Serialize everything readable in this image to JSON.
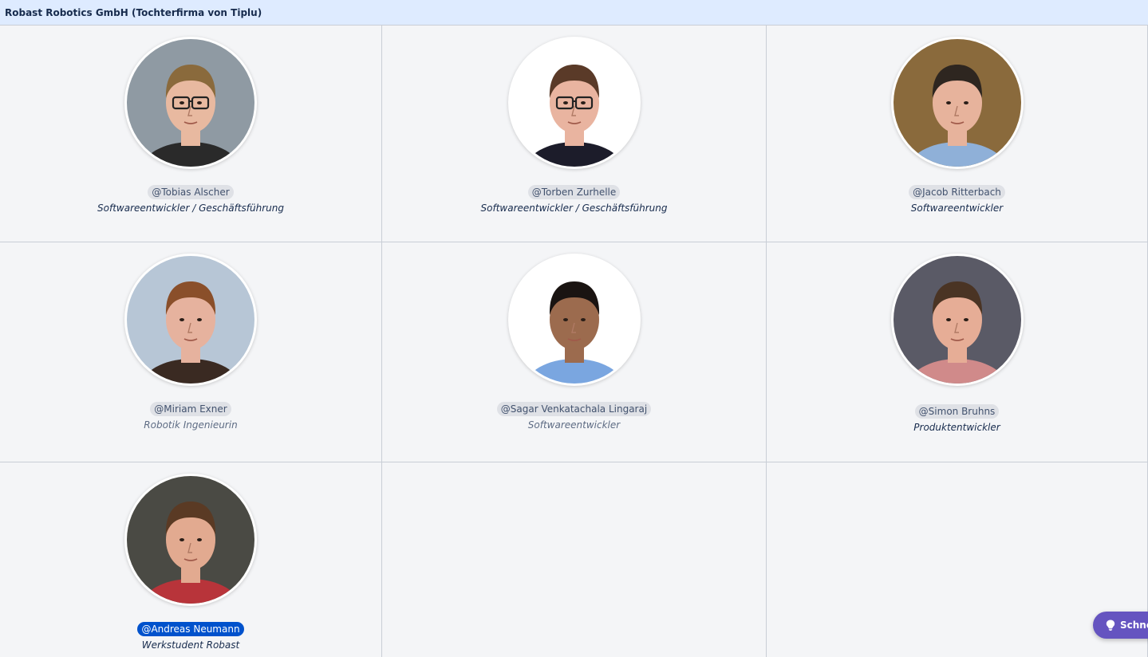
{
  "header": {
    "title": "Robast Robotics GmbH (Tochterfirma von Tiplu)"
  },
  "people": [
    {
      "mention": "@Tobias Alscher",
      "role": "Softwareentwickler / Geschäftsführung",
      "bg": "#8f9aa3",
      "skin": "#e8b9a0",
      "hair": "#8a6a3c",
      "shirt": "#2a2a2a",
      "glasses": true
    },
    {
      "mention": "@Torben Zurhelle",
      "role": "Softwareentwickler / Geschäftsführung",
      "bg": "#ffffff",
      "skin": "#e9b4a0",
      "hair": "#5a3a28",
      "shirt": "#1c1c2a",
      "glasses": true
    },
    {
      "mention": "@Jacob Ritterbach",
      "role": "Softwareentwickler",
      "bg": "#8a6a3c",
      "skin": "#e7b39c",
      "hair": "#2e2620",
      "shirt": "#8fb0d8",
      "glasses": false
    },
    {
      "mention": "@Miriam Exner",
      "role": "Robotik Ingenieurin",
      "bg": "#b7c6d6",
      "skin": "#e6b29e",
      "hair": "#8a4f2a",
      "shirt": "#3a2a22",
      "glasses": false
    },
    {
      "mention": "@Sagar Venkatachala Lingaraj",
      "role": "Softwareentwickler",
      "bg": "#ffffff",
      "skin": "#9c6b4e",
      "hair": "#1a1412",
      "shirt": "#7aa6e0",
      "glasses": false
    },
    {
      "mention": "@Simon Bruhns",
      "role": "Produktentwickler",
      "bg": "#5a5a66",
      "skin": "#e6ad96",
      "hair": "#4a3424",
      "shirt": "#d08a8a",
      "glasses": false
    },
    {
      "mention": "@Andreas Neumann",
      "role": "Werkstudent Robast",
      "bg": "#4a4a44",
      "skin": "#e2aa90",
      "hair": "#5a3a24",
      "shirt": "#b8343a",
      "glasses": false
    }
  ],
  "feedback": {
    "label": "Schne",
    "icon": "lightbulb-icon",
    "color": "#6554c0"
  },
  "colors": {
    "header_bg": "#deebff",
    "selected_mention": "#0052cc"
  }
}
